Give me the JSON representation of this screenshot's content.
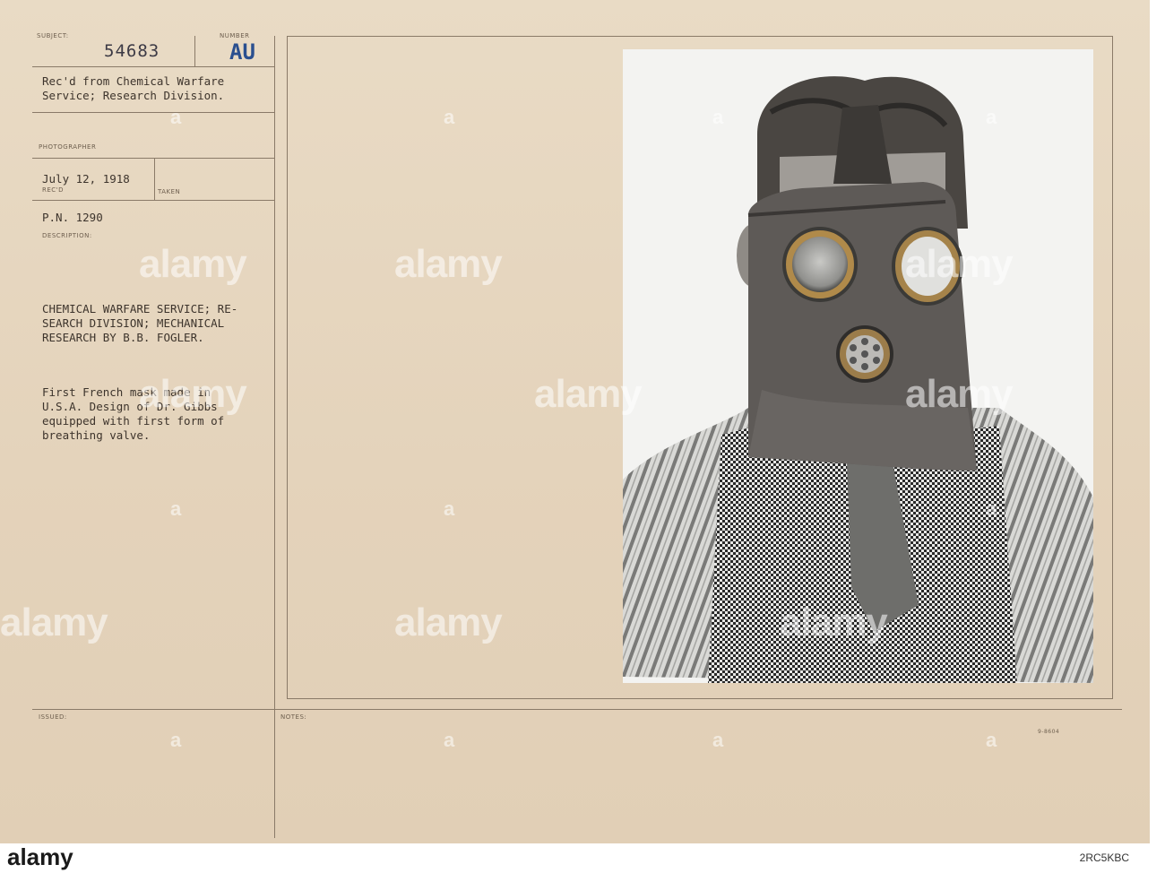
{
  "card": {
    "subject_label": "SUBJECT:",
    "number_label": "NUMBER",
    "subject_number": "54683",
    "number_code": "AU",
    "received_from": "Rec'd from Chemical Warfare\nService; Research Division.",
    "photographer_label": "PHOTOGRAPHER",
    "date": "July 12, 1918",
    "recd_label": "REC'D",
    "taken_label": "TAKEN",
    "pn": "P.N. 1290",
    "description_label": "DESCRIPTION:",
    "description_header": "CHEMICAL WARFARE SERVICE; RE-\nSEARCH DIVISION; MECHANICAL\nRESEARCH BY B.B. FOGLER.",
    "description_body": "First French mask made in\nU.S.A. Design of Dr. Gibbs\nequipped with first form of\nbreathing valve.",
    "issued_label": "ISSUED:",
    "notes_label": "NOTES:",
    "form_code": "9-8604"
  },
  "watermark": {
    "text": "alamy",
    "dot": "a"
  },
  "footer": {
    "brand": "alamy",
    "image_id": "2RC5KBC"
  },
  "colors": {
    "card": "#e7d8c1",
    "ink": "#3d342c",
    "blue_stamp": "#2a4f8f",
    "rule": "#8a7a68"
  },
  "photo": {
    "subject": "man-wearing-gas-mask",
    "icon": "photograph"
  }
}
